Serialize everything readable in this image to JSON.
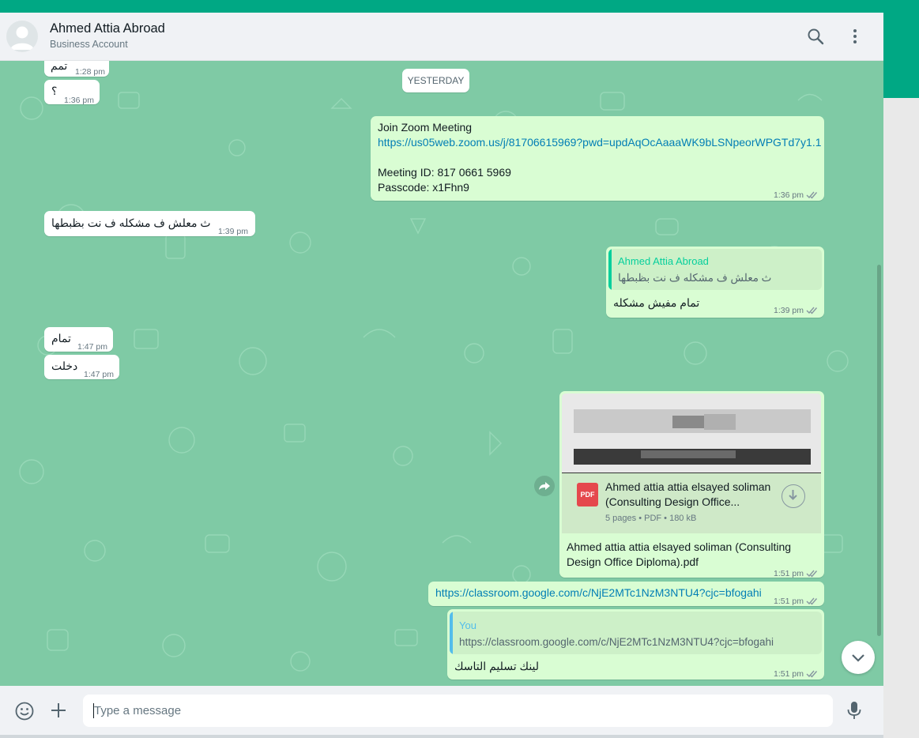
{
  "header": {
    "contact_name": "Ahmed Attia Abroad",
    "contact_subtitle": "Business Account",
    "search_icon": "search-icon",
    "menu_icon": "more-vertical-icon"
  },
  "date_divider": "YESTERDAY",
  "messages": [
    {
      "direction": "in",
      "text": "تمم",
      "time": "1:28 pm"
    },
    {
      "direction": "in",
      "text": "؟",
      "time": "1:36 pm"
    },
    {
      "direction": "out",
      "lines": [
        "Join Zoom Meeting",
        "https://us05web.zoom.us/j/81706615969?pwd=updAqOcAaaaWK9bLSNpeorWPGTd7y1.1",
        "",
        "Meeting ID: 817 0661 5969",
        "Passcode: x1Fhn9"
      ],
      "time": "1:36 pm"
    },
    {
      "direction": "in",
      "text": "ث معلش ف مشكله ف نت بظبطها",
      "time": "1:39 pm"
    },
    {
      "direction": "out",
      "quote_author": "Ahmed Attia Abroad",
      "quote_text": "ث معلش ف مشكله ف نت بظبطها",
      "text": "تمام مفيش مشكله",
      "time": "1:39 pm"
    },
    {
      "direction": "in",
      "text": "تمام",
      "time": "1:47 pm"
    },
    {
      "direction": "in",
      "text": "دخلت",
      "time": "1:47 pm"
    },
    {
      "direction": "out",
      "doc_title_line1": "Ahmed attia attia elsayed soliman",
      "doc_title_line2": "(Consulting Design Office...",
      "doc_meta": "5 pages • PDF • 180 kB",
      "doc_badge": "PDF",
      "caption_line1": "Ahmed attia attia elsayed soliman (Consulting",
      "caption_line2": "Design Office Diploma).pdf",
      "time": "1:51 pm"
    },
    {
      "direction": "out",
      "text": "https://classroom.google.com/c/NjE2MTc1NzM3NTU4?cjc=bfogahi",
      "time": "1:51 pm"
    },
    {
      "direction": "out",
      "quote_author": "You",
      "quote_text": "https://classroom.google.com/c/NjE2MTc1NzM3NTU4?cjc=bfogahi",
      "text": "لينك تسليم التاسك",
      "time": "1:51 pm"
    }
  ],
  "composer": {
    "placeholder": "Type a message",
    "emoji_icon": "emoji-icon",
    "attach_icon": "plus-icon",
    "mic_icon": "microphone-icon"
  },
  "colors": {
    "accent": "#00a884",
    "chat_bg": "#7fcaa5",
    "outgoing_bubble": "#d9fdd3",
    "incoming_bubble": "#ffffff",
    "link": "#027eb5",
    "quote_author_contact": "#06cf9c",
    "quote_author_you": "#53bdeb"
  }
}
